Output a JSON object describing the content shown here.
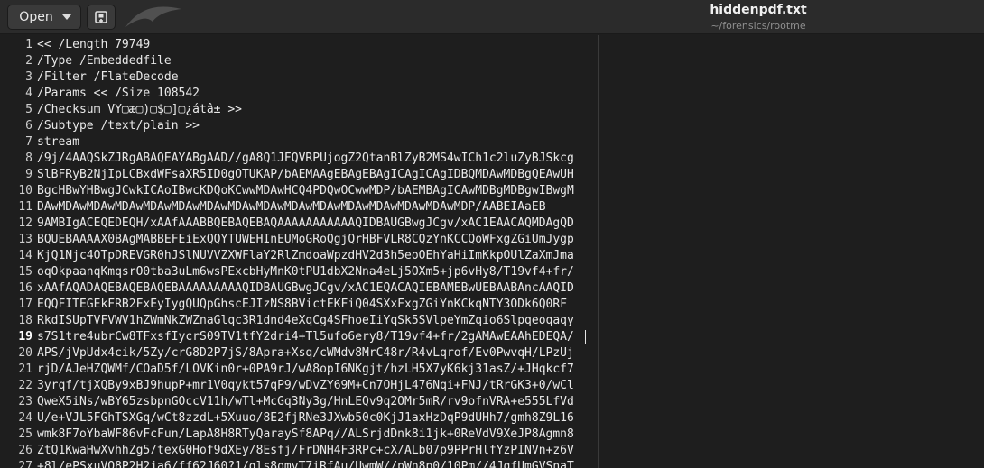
{
  "header": {
    "open_label": "Open",
    "title": "hiddenpdf.txt",
    "path": "~/forensics/rootme"
  },
  "editor": {
    "current_line": 19,
    "lines": [
      {
        "n": "1",
        "text": "<< /Length 79749"
      },
      {
        "n": "2",
        "text": "/Type /Embeddedfile"
      },
      {
        "n": "3",
        "text": "/Filter /FlateDecode"
      },
      {
        "n": "4",
        "text": "/Params << /Size 108542"
      },
      {
        "n": "5",
        "text": "/Checksum VY▢æ▢)▢$▢]▢¿átâ± >>"
      },
      {
        "n": "6",
        "text": "/Subtype /text/plain >>"
      },
      {
        "n": "7",
        "text": "stream"
      },
      {
        "n": "8",
        "text": "/9j/4AAQSkZJRgABAQEAYABgAAD//gA8Q1JFQVRPUjogZ2QtanBlZyB2MS4wICh1c2luZyBJSkcg"
      },
      {
        "n": "9",
        "text": "SlBFRyB2NjIpLCBxdWFsaXR5ID0gOTUKAP/bAEMAAgEBAgEBAgICAgICAgIDBQMDAwMDBgQEAwUH"
      },
      {
        "n": "10",
        "text": "BgcHBwYHBwgJCwkICAoIBwcKDQoKCwwMDAwHCQ4PDQwOCwwMDP/bAEMBAgICAwMDBgMDBgwIBwgM"
      },
      {
        "n": "11",
        "text": "DAwMDAwMDAwMDAwMDAwMDAwMDAwMDAwMDAwMDAwMDAwMDAwMDAwMDAwMDAwMDP/AABEIAaEB"
      },
      {
        "n": "12",
        "text": "9AMBIgACEQEDEQH/xAAfAAABBQEBAQEBAQAAAAAAAAAAAQIDBAUGBwgJCgv/xAC1EAACAQMDAgQD"
      },
      {
        "n": "13",
        "text": "BQUEBAAAAX0BAgMABBEFEiExQQYTUWEHInEUMoGRoQgjQrHBFVLR8CQzYnKCCQoWFxgZGiUmJygp"
      },
      {
        "n": "14",
        "text": "KjQ1Njc4OTpDREVGR0hJSlNUVVZXWFlaY2RlZmdoaWpzdHV2d3h5eoOEhYaHiImKkpOUlZaXmJma"
      },
      {
        "n": "15",
        "text": "oqOkpaanqKmqsrO0tba3uLm6wsPExcbHyMnK0tPU1dbX2Nna4eLj5OXm5+jp6vHy8/T19vf4+fr/"
      },
      {
        "n": "16",
        "text": "xAAfAQADAQEBAQEBAQEBAAAAAAAAAQIDBAUGBwgJCgv/xAC1EQACAQIEBAMEBwUEBAABAncAAQID"
      },
      {
        "n": "17",
        "text": "EQQFITEGEkFRB2FxEyIygQUQpGhscEJIzNS8BVictEKFiQ04SXxFxgZGiYnKCkqNTY3ODk6Q0RF"
      },
      {
        "n": "18",
        "text": "RkdISUpTVFVWV1hZWmNkZWZnaGlqc3R1dnd4eXqCg4SFhoeIiYqSk5SVlpeYmZqio6Slpqeoqaqy"
      },
      {
        "n": "19",
        "text": "s7S1tre4ubrCw8TFxsfIycrS09TV1tfY2dri4+Tl5ufo6ery8/T19vf4+fr/2gAMAwEAAhEDEQA/"
      },
      {
        "n": "20",
        "text": "APS/jVpUdx4cik/5Zy/crG8D2P7jS/8Apra+Xsq/cWMdv8MrC48r/R4vLqrof/Ev0PwvqH/LPzUj"
      },
      {
        "n": "21",
        "text": "rjD/AJeHZQWMf/COaD5f/LOVKin0r+0PA9rJ/wA8opI6NKgjt/hzLH5X7yK6kj31asZ/+JHqkcf7"
      },
      {
        "n": "22",
        "text": "3yrqf/tjXQBy9xBJ9hupP+mr1V0qykt57qP9/wDvZY69M+Cn7OHjL476Nqi+FNJ/tRrGK3+0/wCl"
      },
      {
        "n": "23",
        "text": "QweX5iNs/wBY65zsbpnGOccV11h/wTl+McGq3Ny3g/HnLEQv9q2OMr5mR/rv9ofnVRA+e555LfVd"
      },
      {
        "n": "24",
        "text": "U/e+VJL5FGhTSXGq/wCt8zzdL+5Xuuo/8E2fjRNe3JXwb50c0KjJ1axHzDqP9dUHh7/gmh8Z9L16"
      },
      {
        "n": "25",
        "text": "wmk8F7oYbaWF86vFcFun/LapA8H8RTyQaraySf8APq//ALSrjdDnk8i1jk+0ReVdV9XeJP8Agmn8"
      },
      {
        "n": "26",
        "text": "ZtQ1KwaHwXvhhZg5/texG0Hof9dXEy/8Esfj/FrDNH4F3RPc+cX/ALb07p9PPrHlfYzPINVn+z6V"
      },
      {
        "n": "27",
        "text": "+8l/ePSxuVQ8P2H2ja6/ff62J60?1/gls8omvT7iRfAu/UwmW//pWn8p0/10Pm//4JqfUmGVSnaT"
      }
    ]
  }
}
